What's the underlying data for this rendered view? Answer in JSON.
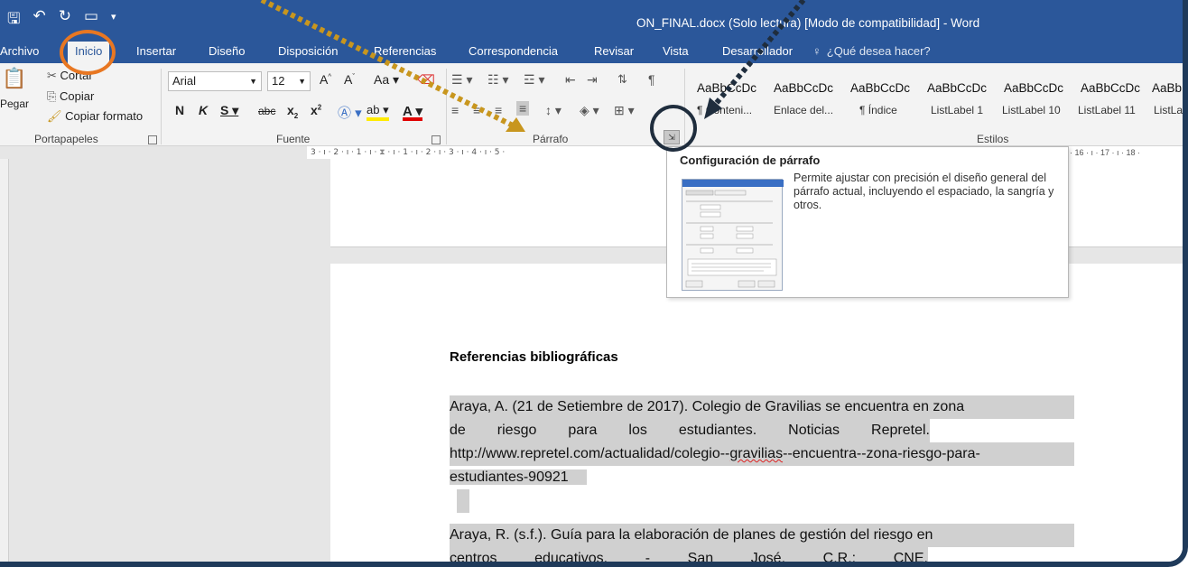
{
  "window": {
    "title": "ON_FINAL.docx (Solo lectura) [Modo de compatibilidad] - Word"
  },
  "tabs": [
    "Archivo",
    "Inicio",
    "Insertar",
    "Diseño",
    "Disposición",
    "Referencias",
    "Correspondencia",
    "Revisar",
    "Vista",
    "Desarrollador"
  ],
  "tell_me": "¿Qué desea hacer?",
  "clipboard": {
    "paste_label": "Pegar",
    "cut_label": "Cortar",
    "copy_label": "Copiar",
    "format_painter_label": "Copiar formato",
    "group_label": "Portapapeles"
  },
  "font": {
    "name": "Arial",
    "size": "12",
    "group_label": "Fuente"
  },
  "paragraph": {
    "group_label": "Párrafo"
  },
  "styles": {
    "group_label": "Estilos",
    "items": [
      {
        "preview": "AaBbCcDc",
        "name": "¶ Conteni..."
      },
      {
        "preview": "AaBbCcDc",
        "name": "Enlace del..."
      },
      {
        "preview": "AaBbCcDc",
        "name": "¶ Índice"
      },
      {
        "preview": "AaBbCcDc",
        "name": "ListLabel 1"
      },
      {
        "preview": "AaBbCcDc",
        "name": "ListLabel 10"
      },
      {
        "preview": "AaBbCcDc",
        "name": "ListLabel 11"
      },
      {
        "preview": "AaBb",
        "name": "ListLab"
      }
    ]
  },
  "ruler": {
    "left_text": "3 · ı · 2 · ı · 1 · ı ·",
    "right_text": "· ı · 1 · ı · 2 · ı · 3 · ı · 4 · ı · 5 ·",
    "end_text": "· 16 · ı · 17 · ı · 18 ·"
  },
  "tooltip": {
    "title": "Configuración de párrafo",
    "description": "Permite ajustar con precisión el diseño general del párrafo actual, incluyendo el espaciado, la sangría y otros."
  },
  "document": {
    "heading": "Referencias bibliográficas",
    "ref1": {
      "line1": "Araya, A. (21 de Setiembre de 2017). Colegio de Gravilias se encuentra en zona",
      "line2_words": [
        "de",
        "riesgo",
        "para",
        "los",
        "estudiantes.",
        "Noticias",
        "Repretel."
      ],
      "line3a": "http://www.repretel.com/actualidad/colegio--",
      "line3b": "gravilias",
      "line3c": "--encuentra--zona-riesgo-para-",
      "line4": "estudiantes-90921"
    },
    "ref2": {
      "line1": "Araya, R. (s.f.). Guía para la elaboración de planes de gestión del riesgo en",
      "line2_words": [
        "centros",
        "educativos.",
        "-",
        "San",
        "José,",
        "C.R.:",
        "CNE."
      ]
    }
  },
  "colors": {
    "word_blue": "#2b579a",
    "highlight_orange": "#e87722",
    "highlight_navy": "#1f2d3d",
    "arrow_gold": "#c8961e",
    "selection_gray": "#d0d0d0"
  }
}
